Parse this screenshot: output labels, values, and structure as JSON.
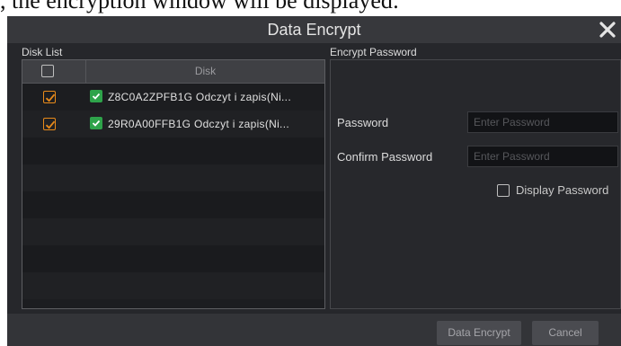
{
  "background_text": ", the encryption window will be displayed:",
  "dialog": {
    "title": "Data Encrypt",
    "close_icon": "close-icon"
  },
  "disk_list": {
    "label": "Disk List",
    "column_header": "Disk",
    "header_checked": false,
    "rows": [
      {
        "checked": true,
        "status_icon": "shield-check-icon",
        "text": "Z8C0A2ZPFB1G Odczyt i zapis(Ni..."
      },
      {
        "checked": true,
        "status_icon": "shield-check-icon",
        "text": "29R0A00FFB1G Odczyt i zapis(Ni..."
      }
    ]
  },
  "encrypt": {
    "label": "Encrypt Password",
    "password_label": "Password",
    "password_placeholder": "Enter Password",
    "confirm_label": "Confirm Password",
    "confirm_placeholder": "Enter Password",
    "display_password_label": "Display Password",
    "display_password_checked": false
  },
  "footer": {
    "data_encrypt_button": "Data Encrypt",
    "cancel_button": "Cancel"
  },
  "colors": {
    "checkbox_checked": "#e88a1a",
    "status_icon": "#2ea34a",
    "dialog_bg": "#26272b"
  }
}
